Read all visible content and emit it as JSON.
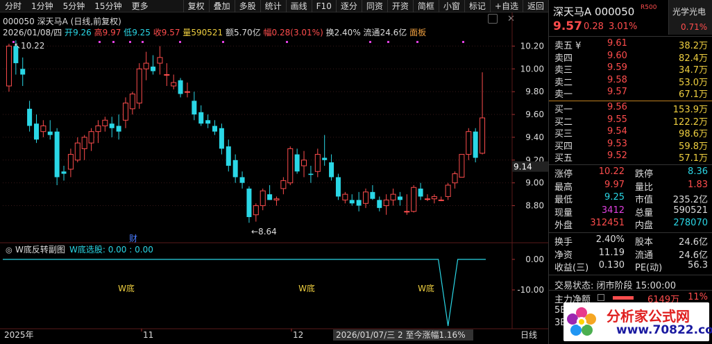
{
  "toolbar": {
    "left_items": [
      "分时",
      "1分钟",
      "5分钟",
      "15分钟",
      "更多"
    ],
    "buttons": [
      "复权",
      "叠加",
      "多股",
      "统计",
      "画线",
      "F10",
      "逐分",
      "同资",
      "开资",
      "简框",
      "小窗",
      "标记",
      "+自选",
      "返回"
    ]
  },
  "header": {
    "title": "000050 深天马A (日线,前复权)",
    "date": "2026/01/08/四",
    "open_label": "开",
    "open": "9.26",
    "high_label": "高",
    "high": "9.97",
    "low_label": "低",
    "low": "9.25",
    "close_label": "收",
    "close": "9.57",
    "volume_label": "量",
    "volume": "590521",
    "amount_label": "额",
    "amount": "5.70亿",
    "amp_label": "幅",
    "amp": "0.28(3.01%)",
    "turnover_label": "换",
    "turnover": "2.40%",
    "float_label": "流通",
    "float": "24.6亿",
    "board": "面板"
  },
  "subchart": {
    "title": "W底反转副图",
    "indicator": "W底选股: 0.00 : 0.00",
    "w_labels": [
      "W底",
      "W底",
      "W底"
    ]
  },
  "annotations": {
    "high_mark": "10.22",
    "low_mark": "8.64",
    "cai": "财"
  },
  "bottom": {
    "dates": [
      "2025年",
      "11",
      "12"
    ],
    "cursor_info": "2026/01/07/三  2 至今涨幅1.16%",
    "rightlabel": "日线"
  },
  "chart_data": {
    "type": "candlestick",
    "price_axis": {
      "ticks": [
        8.8,
        9.0,
        9.2,
        9.4,
        9.6,
        9.8,
        10.0,
        10.2
      ],
      "ylim": [
        8.56,
        10.3
      ],
      "cursor_value": "9.14"
    },
    "sub_axis": {
      "ticks": [
        "0.00",
        "-10.00"
      ]
    },
    "candles": [
      [
        9.85,
        10.22,
        9.8,
        10.2
      ],
      [
        10.2,
        10.25,
        9.95,
        10.05
      ],
      [
        10.0,
        10.1,
        9.85,
        9.95
      ],
      [
        9.65,
        9.72,
        9.45,
        9.5
      ],
      [
        9.52,
        9.6,
        9.35,
        9.38
      ],
      [
        9.45,
        9.55,
        9.4,
        9.5
      ],
      [
        9.45,
        9.55,
        9.38,
        9.42
      ],
      [
        9.45,
        9.48,
        8.98,
        9.05
      ],
      [
        9.1,
        9.15,
        9.02,
        9.08
      ],
      [
        9.12,
        9.3,
        9.05,
        9.25
      ],
      [
        9.2,
        9.4,
        9.18,
        9.35
      ],
      [
        9.3,
        9.42,
        9.2,
        9.4
      ],
      [
        9.35,
        9.48,
        9.28,
        9.45
      ],
      [
        9.45,
        9.55,
        9.35,
        9.5
      ],
      [
        9.5,
        9.58,
        9.45,
        9.55
      ],
      [
        9.52,
        9.58,
        9.4,
        9.48
      ],
      [
        9.5,
        9.6,
        9.38,
        9.45
      ],
      [
        9.55,
        9.75,
        9.48,
        9.7
      ],
      [
        9.65,
        9.8,
        9.6,
        9.78
      ],
      [
        9.7,
        10.05,
        9.65,
        10.0
      ],
      [
        10.0,
        10.15,
        9.9,
        10.05
      ],
      [
        10.02,
        10.12,
        9.95,
        9.98
      ],
      [
        10.05,
        10.2,
        9.95,
        10.1
      ],
      [
        9.95,
        10.05,
        9.85,
        9.95
      ],
      [
        9.85,
        9.95,
        9.82,
        9.88
      ],
      [
        9.9,
        9.92,
        9.75,
        9.78
      ],
      [
        9.8,
        9.88,
        9.75,
        9.8
      ],
      [
        9.72,
        9.8,
        9.55,
        9.6
      ],
      [
        9.62,
        9.68,
        9.5,
        9.52
      ],
      [
        9.55,
        9.6,
        9.48,
        9.52
      ],
      [
        9.5,
        9.55,
        9.42,
        9.45
      ],
      [
        9.48,
        9.52,
        9.25,
        9.3
      ],
      [
        9.32,
        9.38,
        9.1,
        9.15
      ],
      [
        9.2,
        9.25,
        9.0,
        9.05
      ],
      [
        9.05,
        9.1,
        8.95,
        9.0
      ],
      [
        8.95,
        8.97,
        8.65,
        8.7
      ],
      [
        8.72,
        8.82,
        8.66,
        8.8
      ],
      [
        8.8,
        8.95,
        8.76,
        8.93
      ],
      [
        8.9,
        8.98,
        8.85,
        8.85
      ],
      [
        8.85,
        8.88,
        8.8,
        8.86
      ],
      [
        8.95,
        9.05,
        8.9,
        9.02
      ],
      [
        9.0,
        9.32,
        8.98,
        9.3
      ],
      [
        9.25,
        9.3,
        9.08,
        9.1
      ],
      [
        9.15,
        9.28,
        9.05,
        9.2
      ],
      [
        9.08,
        9.15,
        9.0,
        9.07
      ],
      [
        9.1,
        9.3,
        9.05,
        9.25
      ],
      [
        9.22,
        9.42,
        9.15,
        9.2
      ],
      [
        9.18,
        9.25,
        9.02,
        9.05
      ],
      [
        9.05,
        9.08,
        8.85,
        8.88
      ],
      [
        8.85,
        8.92,
        8.82,
        8.9
      ],
      [
        8.85,
        8.9,
        8.8,
        8.82
      ],
      [
        8.85,
        8.92,
        8.75,
        8.8
      ],
      [
        8.82,
        8.95,
        8.78,
        8.92
      ],
      [
        8.92,
        8.98,
        8.85,
        8.86
      ],
      [
        8.85,
        8.88,
        8.75,
        8.78
      ],
      [
        8.8,
        8.9,
        8.72,
        8.85
      ],
      [
        8.85,
        8.95,
        8.8,
        8.9
      ],
      [
        8.88,
        8.92,
        8.8,
        8.85
      ],
      [
        8.75,
        8.9,
        8.72,
        8.75
      ],
      [
        8.75,
        8.98,
        8.74,
        8.96
      ],
      [
        8.95,
        9.0,
        8.85,
        8.88
      ],
      [
        8.86,
        8.9,
        8.84,
        8.86
      ],
      [
        8.86,
        8.9,
        8.82,
        8.88
      ],
      [
        8.85,
        8.88,
        8.84,
        8.85
      ],
      [
        8.88,
        9.0,
        8.85,
        8.98
      ],
      [
        9.0,
        9.1,
        8.95,
        9.08
      ],
      [
        9.05,
        9.25,
        9.05,
        9.25
      ],
      [
        9.25,
        9.48,
        9.2,
        9.45
      ],
      [
        9.45,
        9.48,
        9.18,
        9.22
      ],
      [
        9.26,
        9.97,
        9.25,
        9.57
      ]
    ],
    "w_signal": {
      "type": "line",
      "baseline": 0.0,
      "dip_min": -10.0
    }
  },
  "panel": {
    "name": "深天马A",
    "code": "000050",
    "badge": "R500",
    "sector": "光学光电",
    "price": "9.57",
    "change": "0.28",
    "pct": "3.01%",
    "sector_pct": "0.71%",
    "asks": [
      [
        "卖五 ¥",
        "9.61",
        "38.2万"
      ],
      [
        "卖四",
        "9.60",
        "82.4万"
      ],
      [
        "卖三",
        "9.59",
        "34.7万"
      ],
      [
        "卖二",
        "9.58",
        "53.0万"
      ],
      [
        "卖一",
        "9.57",
        "67.1万"
      ]
    ],
    "bids": [
      [
        "买一",
        "9.56",
        "153.9万"
      ],
      [
        "买二",
        "9.55",
        "122.2万"
      ],
      [
        "买三",
        "9.54",
        "98.6万"
      ],
      [
        "买四",
        "9.53",
        "59.8万"
      ],
      [
        "买五",
        "9.52",
        "57.1万"
      ]
    ],
    "stats_left": [
      [
        "涨停",
        "10.22"
      ],
      [
        "最高",
        "9.97"
      ],
      [
        "最低",
        "9.25"
      ],
      [
        "现量",
        "3412"
      ],
      [
        "外盘",
        "312451"
      ]
    ],
    "stats_right": [
      [
        "跌停",
        "8.36"
      ],
      [
        "量比",
        "1.83"
      ],
      [
        "市值",
        "235.2亿"
      ],
      [
        "总量",
        "590521"
      ],
      [
        "内盘",
        "278070"
      ]
    ],
    "stats2_left": [
      [
        "换手",
        "2.40%"
      ],
      [
        "净资",
        "11.19"
      ],
      [
        "收益(三)",
        "0.130"
      ]
    ],
    "stats2_right": [
      [
        "股本",
        "24.6亿"
      ],
      [
        "流通",
        "24.6亿"
      ],
      [
        "PE(动)",
        "56.3"
      ]
    ],
    "trade_status": "交易状态: 闭市阶段 15:00:00",
    "main_flow_label": "主力净额",
    "main_flow_value": "6149万",
    "main_flow_pct": "11%",
    "row_5e": "5E",
    "row_3e": "3E"
  },
  "logo": {
    "text1": "分析家公式网",
    "text2": "www.70822.com"
  },
  "colors": {
    "up": "#ff4d4d",
    "down": "#2ad7e6",
    "bg": "#000000",
    "grid": "#3a1a1a"
  }
}
